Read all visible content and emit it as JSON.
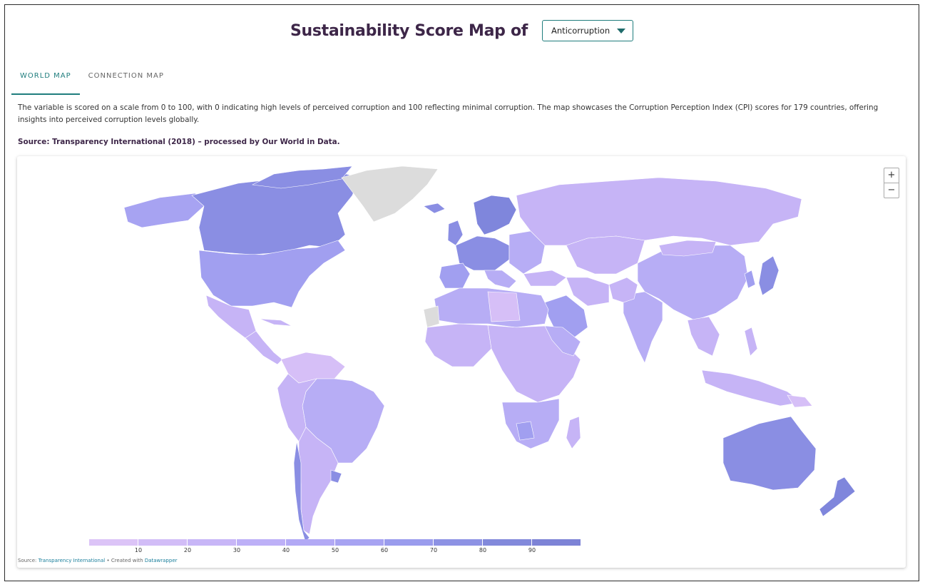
{
  "header": {
    "title": "Sustainability Score Map of",
    "select_value": "Anticorruption"
  },
  "tabs": [
    {
      "label": "WORLD MAP",
      "active": true
    },
    {
      "label": "CONNECTION MAP",
      "active": false
    }
  ],
  "description": "The variable is scored on a scale from 0 to 100, with 0 indicating high levels of perceived corruption and 100 reflecting minimal corruption. The map showcases the Corruption Perception Index (CPI) scores for 179 countries, offering insights into perceived corruption levels globally.",
  "source_line": "Source: Transparency International (2018) – processed by Our World in Data.",
  "map": {
    "zoom_in_label": "+",
    "zoom_out_label": "−",
    "legend": {
      "ticks": [
        "10",
        "20",
        "30",
        "40",
        "50",
        "60",
        "70",
        "80",
        "90"
      ],
      "colors": [
        "#dcc4f7",
        "#d2bdf7",
        "#c8b6f7",
        "#bdb0f7",
        "#b2a9f5",
        "#a7a3f2",
        "#9a9ced",
        "#8d92e4",
        "#8289db",
        "#7d83d6"
      ]
    },
    "credit": {
      "prefix": "Source: ",
      "source_link": "Transparency International",
      "middle": " • Created with ",
      "tool_link": "Datawrapper"
    },
    "colors": {
      "no_data": "#dcdcdc",
      "low": "#d6bff7",
      "mid_low": "#c6b4f6",
      "mid": "#b7adf5",
      "mid_high": "#a19ff0",
      "high": "#8a8ee3",
      "top": "#7f86dc"
    }
  }
}
